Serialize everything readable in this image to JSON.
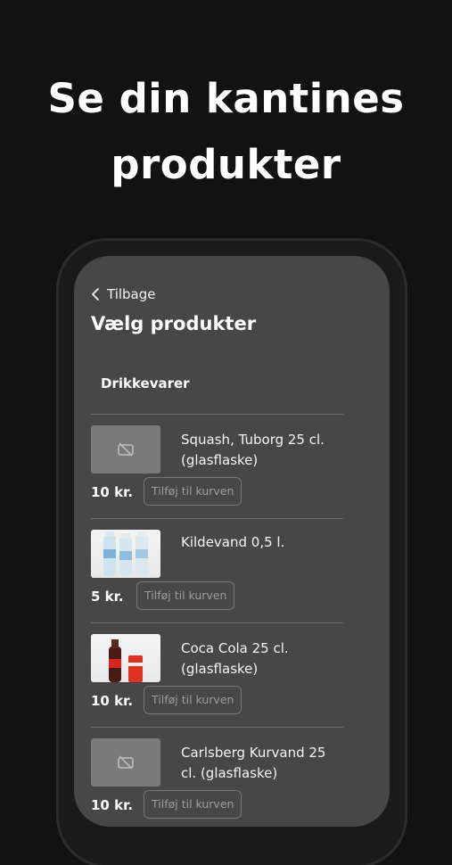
{
  "hero": {
    "line1": "Se din kantines",
    "line2": "produkter"
  },
  "nav": {
    "back_label": "Tilbage"
  },
  "page": {
    "title": "Vælg produkter",
    "category": "Drikkevarer"
  },
  "products": [
    {
      "name": "Squash, Tuborg 25 cl. (glasflaske)",
      "price": "10 kr.",
      "add_label": "Tilføj til kurven",
      "image": "no-image-icon"
    },
    {
      "name": "Kildevand 0,5 l.",
      "price": "5 kr.",
      "add_label": "Tilføj til kurven",
      "image": "water-bottles-photo"
    },
    {
      "name": "Coca Cola 25 cl. (glasflaske)",
      "price": "10 kr.",
      "add_label": "Tilføj til kurven",
      "image": "cola-bottles-photo"
    },
    {
      "name": "Carlsberg Kurvand 25 cl. (glasflaske)",
      "price": "10 kr.",
      "add_label": "Tilføj til kurven",
      "image": "no-image-icon"
    }
  ]
}
